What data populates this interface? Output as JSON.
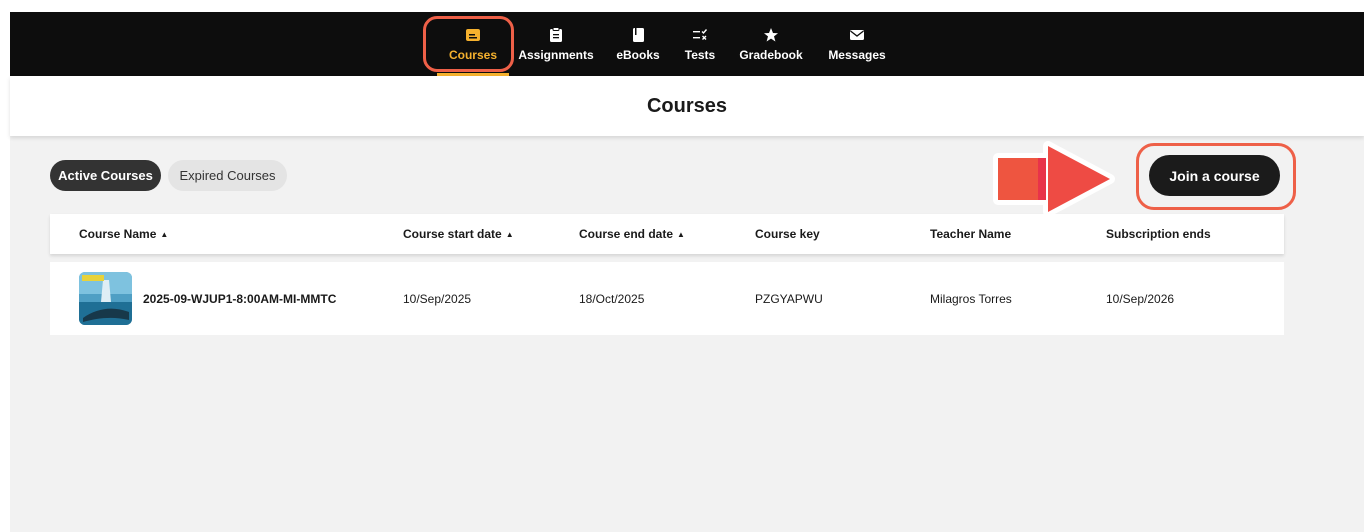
{
  "nav": {
    "items": [
      {
        "label": "Courses",
        "icon": "folder-icon"
      },
      {
        "label": "Assignments",
        "icon": "clipboard-icon"
      },
      {
        "label": "eBooks",
        "icon": "book-icon"
      },
      {
        "label": "Tests",
        "icon": "checklist-icon"
      },
      {
        "label": "Gradebook",
        "icon": "star-icon"
      },
      {
        "label": "Messages",
        "icon": "envelope-icon"
      }
    ],
    "active": "Courses"
  },
  "header": {
    "title": "Courses"
  },
  "tabs": {
    "active": "Active Courses",
    "inactive": "Expired Courses"
  },
  "join_button": "Join a course",
  "table": {
    "columns": [
      "Course Name",
      "Course start date",
      "Course end date",
      "Course key",
      "Teacher Name",
      "Subscription ends"
    ],
    "sort_indicator": "▲",
    "rows": [
      {
        "name": "2025-09-WJUP1-8:00AM-MI-MMTC",
        "start": "10/Sep/2025",
        "end": "18/Oct/2025",
        "key": "PZGYAPWU",
        "teacher": "Milagros Torres",
        "subscription_ends": "10/Sep/2026"
      }
    ]
  },
  "colors": {
    "accent": "#f5b12e",
    "highlight": "#ee6048",
    "nav_bg": "#0d0d0d"
  }
}
